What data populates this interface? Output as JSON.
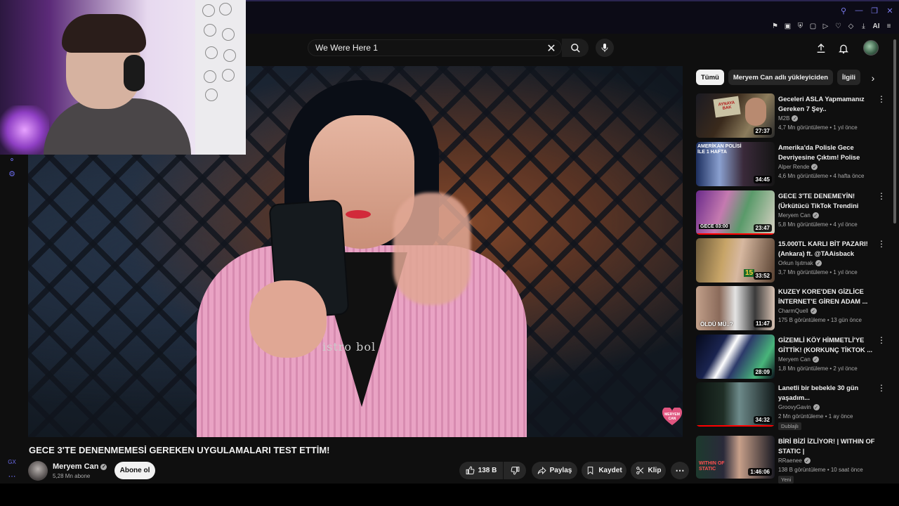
{
  "browser": {
    "window_controls": [
      "search-icon",
      "minimize-icon",
      "restore-icon",
      "close-icon"
    ],
    "extensions": [
      "pin-icon",
      "screenshot-icon",
      "shield-icon",
      "ublock-icon",
      "play-icon",
      "heart-icon",
      "download-icon",
      "ai-icon",
      "menu-icon"
    ],
    "ai_label": "AI"
  },
  "header": {
    "search_value": "We Were Here 1"
  },
  "video": {
    "title": "GECE 3'TE DENENMEMESİ GEREKEN UYGULAMALARI TEST ETTİM!",
    "shirt_text": "istro bol",
    "watermark": "MERYEM CAN",
    "channel": {
      "name": "Meryem Can",
      "subscribers": "5,28 Mn abone",
      "subscribe_label": "Abone ol"
    },
    "actions": {
      "likes": "138 B",
      "share": "Paylaş",
      "save": "Kaydet",
      "clip": "Klip"
    }
  },
  "chips": [
    "Tümü",
    "Meryem Can adlı yükleyiciden",
    "İlgili"
  ],
  "related": [
    {
      "title": "Geceleri ASLA Yapmamanız Gereken 7 Şey..",
      "channel": "M2B",
      "meta": "4,7 Mn görüntüleme • 1 yıl önce",
      "duration": "27:37",
      "thumb_text": "AYNAYA BAK"
    },
    {
      "title": "Amerika'da Polisle Gece Devriyesine Çıktım! Polise Küf...",
      "channel": "Alper Rende",
      "meta": "4,6 Mn görüntüleme • 4 hafta önce",
      "duration": "34:45",
      "thumb_text": "AMERİKAN POLİSİ İLE 1 HAFTA"
    },
    {
      "title": "GECE 3'TE DENEMEYİN! (Ürkütücü TikTok Trendini Test...",
      "channel": "Meryem Can",
      "meta": "5,8 Mn görüntüleme • 4 yıl önce",
      "duration": "23:47",
      "thumb_text": "GECE 03:00",
      "progress": 1.0
    },
    {
      "title": "15.000TL KARLI BİT PAZARI! (Ankara) ft. @TAAisback",
      "channel": "Orkun Işıtmak",
      "meta": "3,7 Mn görüntüleme • 1 yıl önce",
      "duration": "33:52",
      "thumb_text": "15"
    },
    {
      "title": "KUZEY KORE'DEN GİZLİCE İNTERNET'E GİREN ADAM ...",
      "channel": "CharmQuell",
      "meta": "175 B görüntüleme • 13 gün önce",
      "duration": "11:47",
      "thumb_text": "ÖLDÜ MÜ..?"
    },
    {
      "title": "GİZEMLİ KÖY HİMMETLİ'YE GİTTİK! (KORKUNÇ TİKTOK ...",
      "channel": "Meryem Can",
      "meta": "1,8 Mn görüntüleme • 2 yıl önce",
      "duration": "28:09",
      "thumb_text": ""
    },
    {
      "title": "Lanetli bir bebekle 30 gün yaşadım...",
      "channel": "GroovyGavin",
      "meta": "2 Mn görüntüleme • 1 ay önce",
      "duration": "34:32",
      "badge": "Dublajlı",
      "thumb_text": "",
      "progress": 1.0
    },
    {
      "title": "BİRİ BİZİ İZLİYOR! | WITHIN OF STATIC |",
      "channel": "RRaenee",
      "meta": "138 B görüntüleme • 10 saat önce",
      "duration": "1:46:06",
      "badge": "Yeni",
      "thumb_text": "WITHIN OF STATIC"
    }
  ],
  "colors": {
    "accent": "#f1f1f1",
    "background": "#0f0f0f",
    "progress_red": "#ff0000",
    "window_control": "#7c7cf0"
  }
}
